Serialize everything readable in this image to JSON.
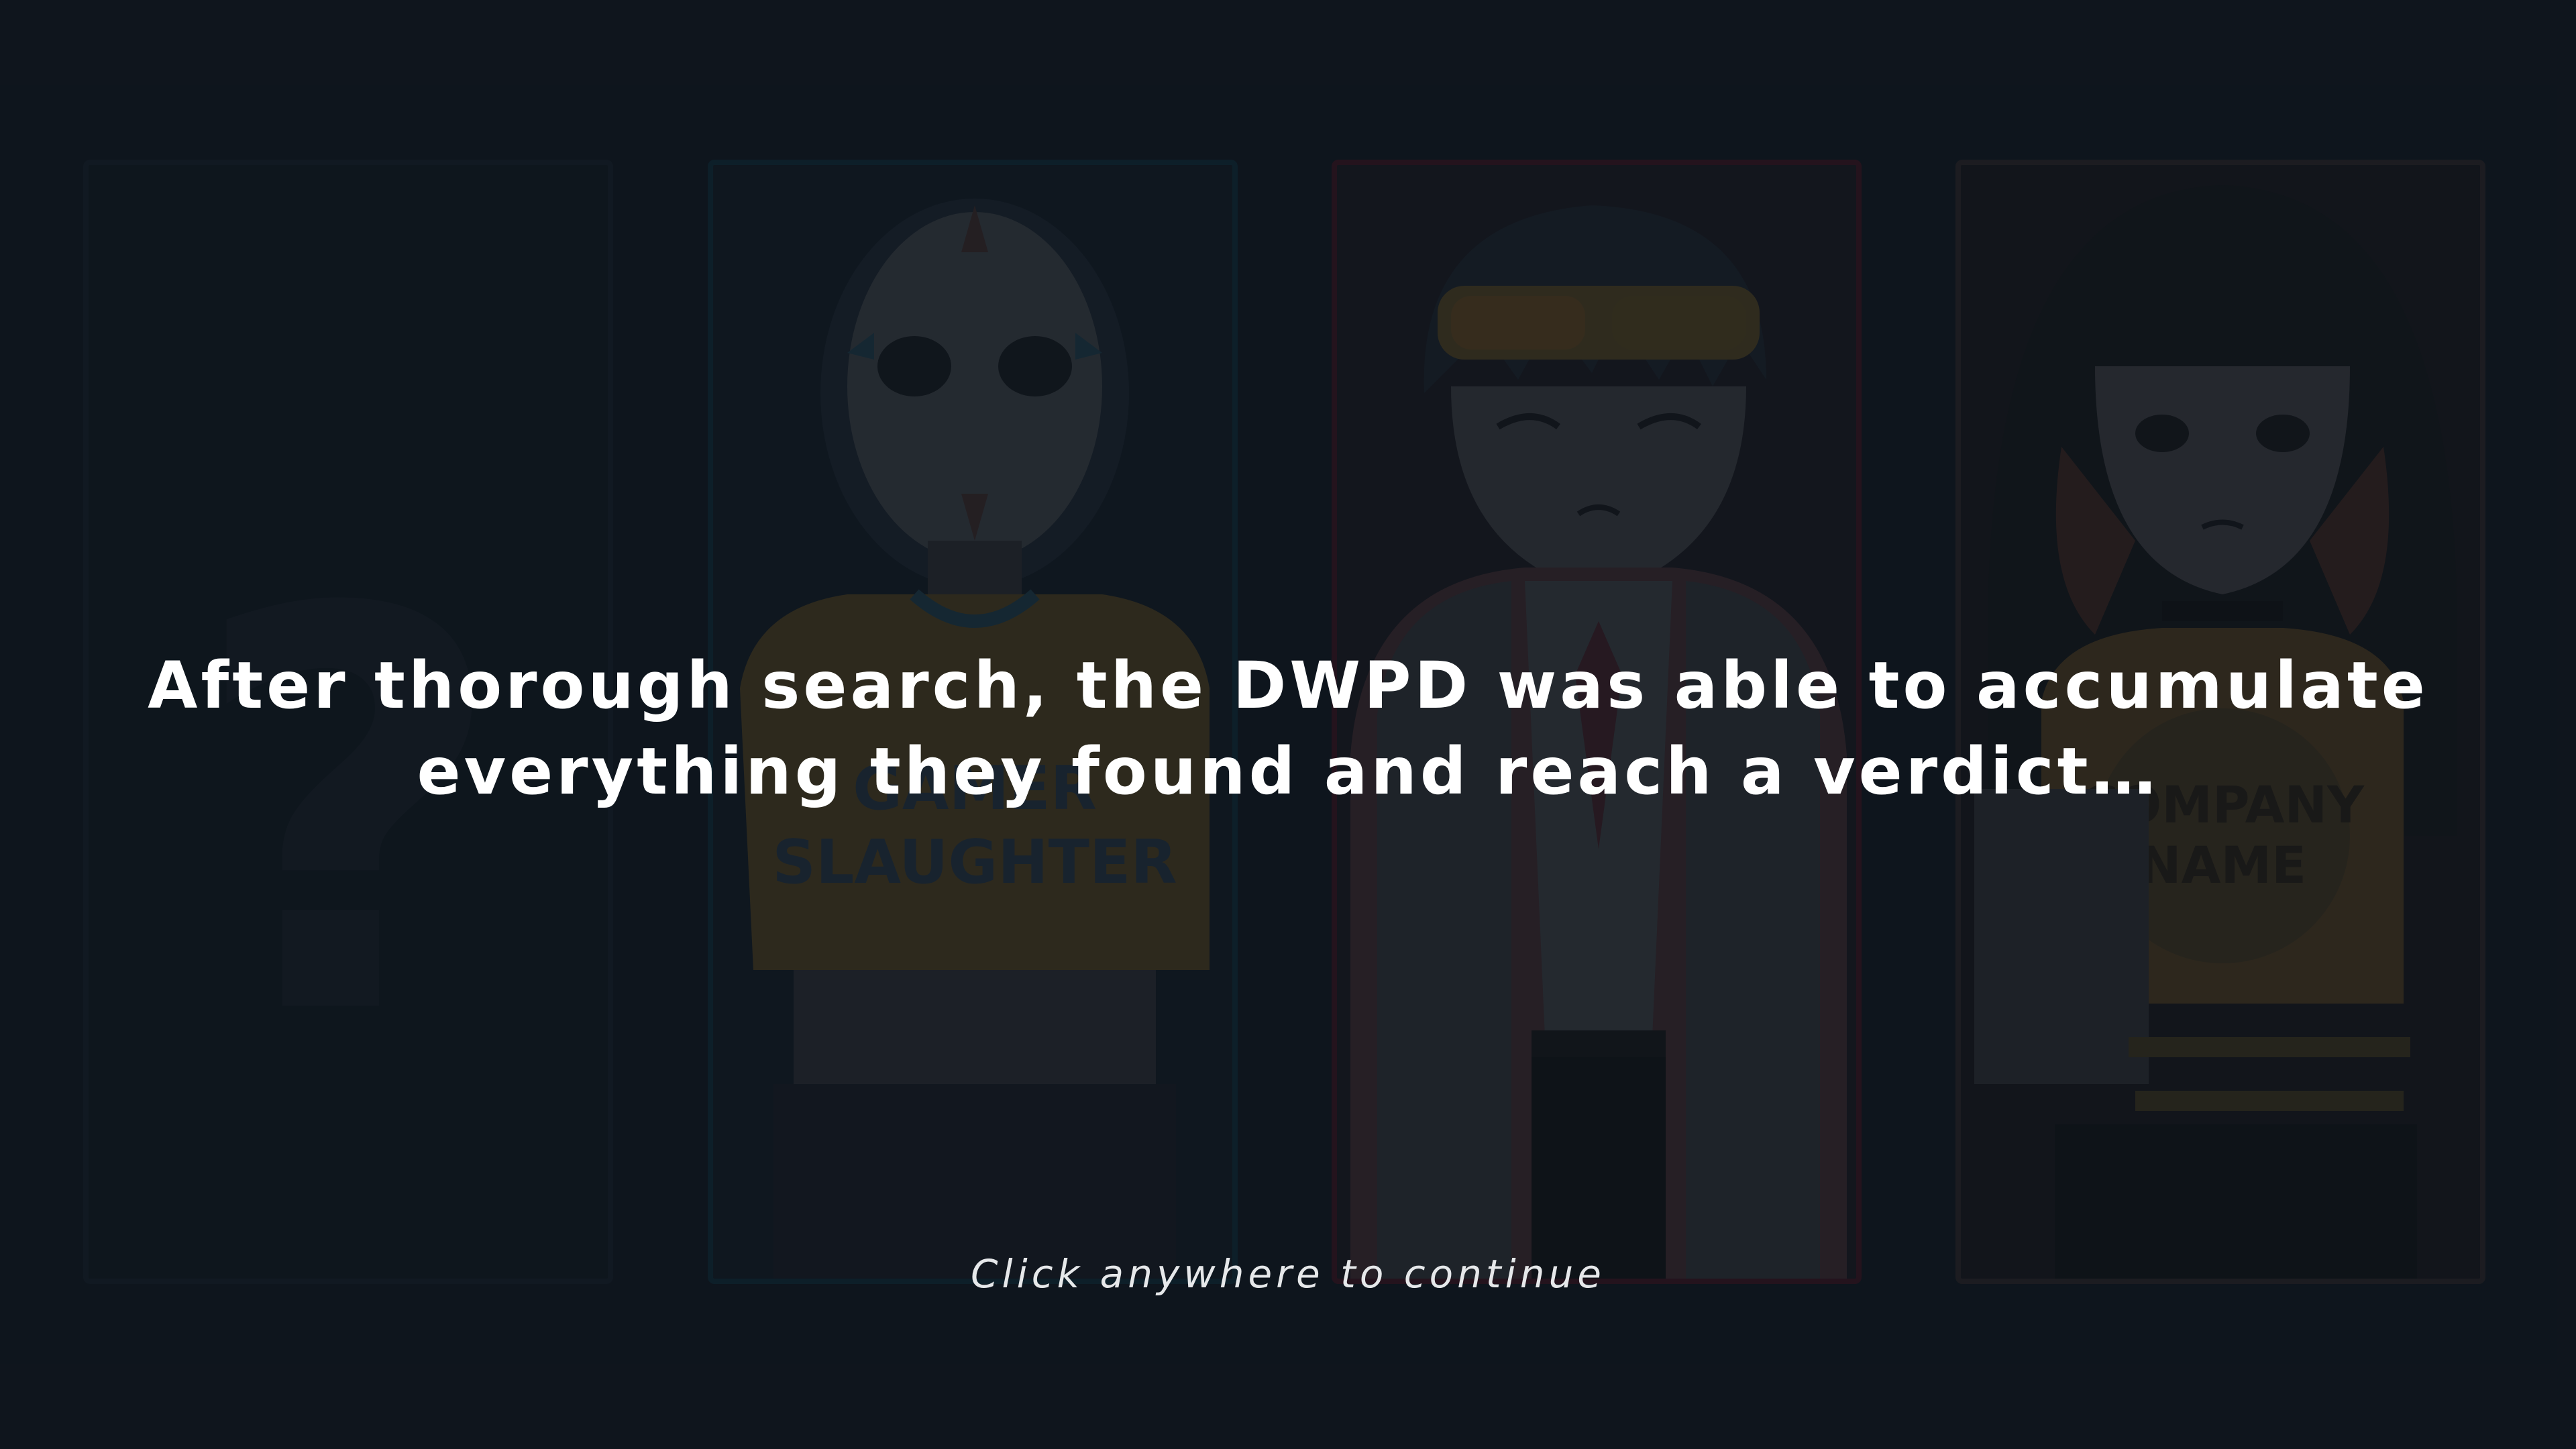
{
  "narration": {
    "text": "After thorough search, the DWPD was able to accumulate\neverything they found and reach a verdict…"
  },
  "prompt": {
    "text": "Click anywhere to continue"
  },
  "cards": [
    {
      "id": "unknown",
      "symbol": "?",
      "border_color": "#17202a"
    },
    {
      "id": "masked-suspect",
      "shirt_text": "GAMER SLAUGHTER",
      "border_color": "#0f2a38"
    },
    {
      "id": "goggles-suspect",
      "border_color": "#3a1422"
    },
    {
      "id": "hooded-suspect",
      "shirt_text": "COMPANY NAME",
      "border_color": "#2a2628"
    }
  ],
  "colors": {
    "background": "#111821",
    "text": "#ffffff"
  }
}
